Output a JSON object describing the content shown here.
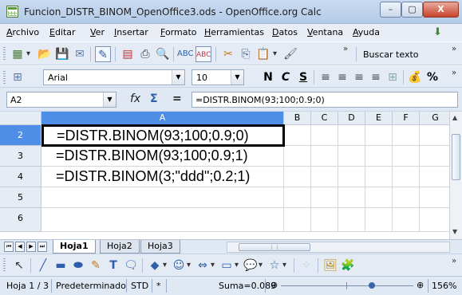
{
  "window": {
    "title": "Funcion_DISTR_BINOM_OpenOffice3.ods - OpenOffice.org Calc",
    "min_label": "–",
    "max_label": "▢",
    "close_label": "X"
  },
  "menu": [
    "Archivo",
    "Editar",
    "Ver",
    "Insertar",
    "Formato",
    "Herramientas",
    "Datos",
    "Ventana",
    "Ayuda"
  ],
  "toolbar": {
    "find_label": "Buscar texto",
    "font_name": "Arial",
    "font_size": "10",
    "bold_label": "N",
    "italic_label": "C",
    "underline_label": "S",
    "percent_label": "%"
  },
  "formula_bar": {
    "cell_ref": "A2",
    "fx_label": "fx",
    "sum_label": "Σ",
    "equals_label": "=",
    "content": "=DISTR.BINOM(93;100;0.9;0)"
  },
  "grid": {
    "columns": [
      "A",
      "B",
      "C",
      "D",
      "E",
      "F",
      "G"
    ],
    "rows": [
      "2",
      "3",
      "4",
      "5",
      "6"
    ],
    "cells": [
      "=DISTR.BINOM(93;100;0.9;0)",
      "=DISTR.BINOM(93;100;0.9;1)",
      "=DISTR.BINOM(3;\"ddd\";0.2;1)"
    ]
  },
  "sheets": [
    "Hoja1",
    "Hoja2",
    "Hoja3"
  ],
  "status": {
    "sheet_pos": "Hoja 1 / 3",
    "style": "Predeterminado",
    "mode": "STD",
    "modified": "*",
    "sum": "Suma=0.089",
    "zoom": "156%"
  },
  "colors": {
    "selected_header": "#4f8ee6",
    "toolbar_bg": "#e4ebf5"
  }
}
